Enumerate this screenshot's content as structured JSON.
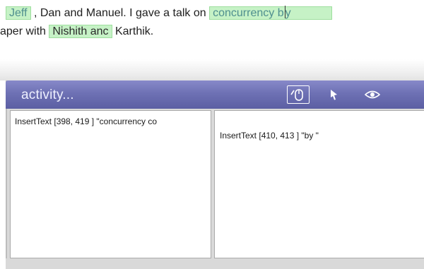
{
  "document": {
    "line1": {
      "hl_name": "Jeff",
      "text_a": " , Dan and Manuel. I gave a talk on ",
      "hl_phrase_a": "concurrency b",
      "hl_phrase_b": "y"
    },
    "line2": {
      "text_a": "aper with ",
      "hl_name": "Nishith anc",
      "text_b": " Karthik."
    }
  },
  "activity_panel": {
    "title": "activity...",
    "icons": [
      "mouse-icon",
      "pointer-icon",
      "eye-icon"
    ],
    "left_pane": {
      "entry": "InsertText [398, 419 ] \"concurrency co"
    },
    "right_pane": {
      "entry": "InsertText [410, 413 ] \"by \""
    }
  },
  "colors": {
    "highlight_bg": "#c6f2c6",
    "highlight_border": "#9ede9e",
    "header_top": "#8789c9",
    "header_bottom": "#5b5ea3",
    "panel_bg": "#d9d9d9"
  }
}
